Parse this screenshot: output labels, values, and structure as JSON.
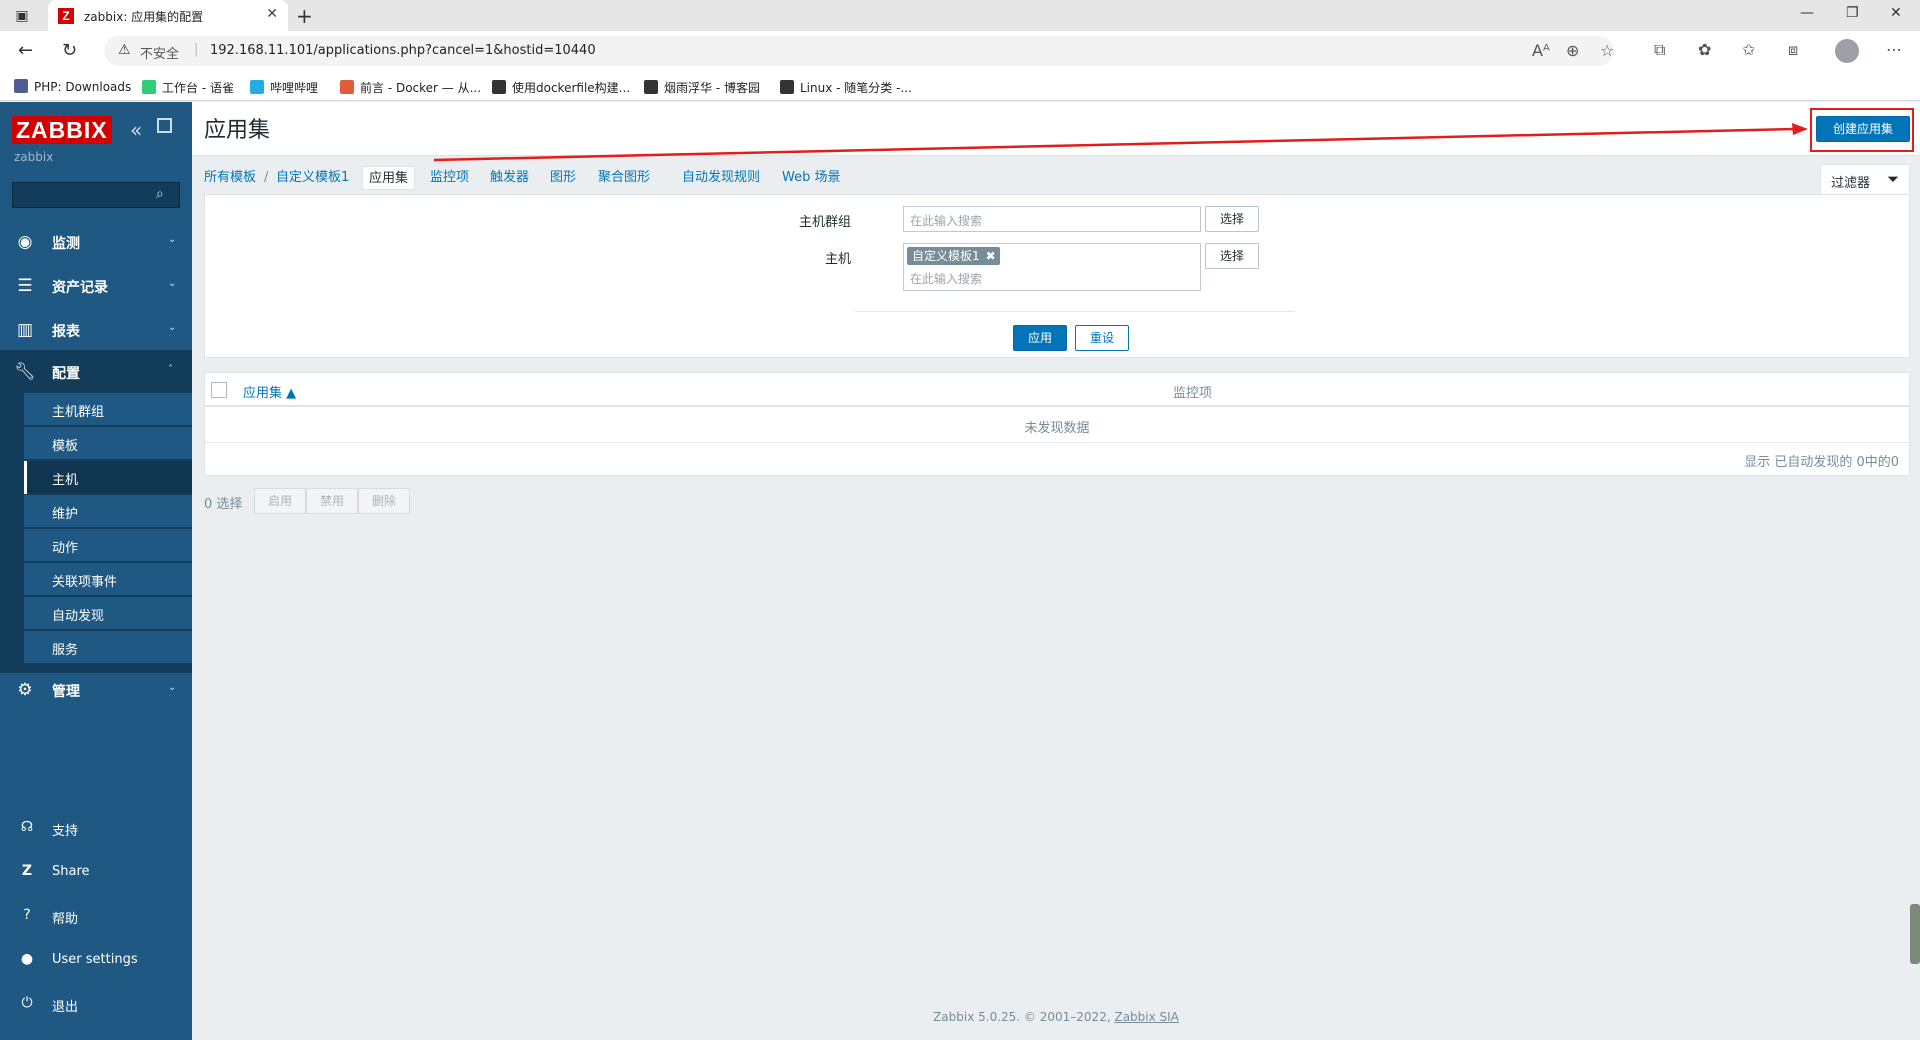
{
  "browser": {
    "tab_title": "zabbix: 应用集的配置",
    "tab_favicon": "Z",
    "insecure_label": "不安全",
    "url": "192.168.11.101/applications.php?cancel=1&hostid=10440",
    "bookmarks": [
      {
        "label": "PHP: Downloads",
        "icon": "php-icon",
        "color": "#4f5b93"
      },
      {
        "label": "工作台 - 语雀",
        "icon": "yuque-icon",
        "color": "#31cc79"
      },
      {
        "label": "哔哩哔哩",
        "icon": "bilibili-icon",
        "color": "#23ade5"
      },
      {
        "label": "前言 - Docker — 从...",
        "icon": "rocket-icon",
        "color": "#e25c3a"
      },
      {
        "label": "使用dockerfile构建...",
        "icon": "cnblogs-icon",
        "color": "#333333"
      },
      {
        "label": "烟雨浮华 - 博客园",
        "icon": "cnblogs-icon",
        "color": "#333333"
      },
      {
        "label": "Linux - 随笔分类 -...",
        "icon": "cnblogs-icon",
        "color": "#333333"
      }
    ]
  },
  "sidebar": {
    "logo": "ZABBIX",
    "server_name": "zabbix",
    "menu": [
      {
        "label": "监测",
        "icon": "eye-icon"
      },
      {
        "label": "资产记录",
        "icon": "list-icon"
      },
      {
        "label": "报表",
        "icon": "chart-icon"
      },
      {
        "label": "配置",
        "icon": "wrench-icon"
      },
      {
        "label": "管理",
        "icon": "gear-icon"
      }
    ],
    "submenu": [
      "主机群组",
      "模板",
      "主机",
      "维护",
      "动作",
      "关联项事件",
      "自动发现",
      "服务"
    ],
    "active_submenu": "主机",
    "bottom": [
      {
        "label": "支持",
        "icon": "headset-icon"
      },
      {
        "label": "Share",
        "icon": "share-icon"
      },
      {
        "label": "帮助",
        "icon": "help-icon"
      },
      {
        "label": "User settings",
        "icon": "user-icon"
      },
      {
        "label": "退出",
        "icon": "power-icon"
      }
    ]
  },
  "header": {
    "title": "应用集",
    "create_button": "创建应用集"
  },
  "nav": {
    "all_templates": "所有模板",
    "separator": "/",
    "template": "自定义模板1",
    "tabs": [
      "应用集",
      "监控项",
      "触发器",
      "图形",
      "聚合图形",
      "自动发现规则",
      "Web 场景"
    ],
    "active_tab": "应用集",
    "filter_label": "过滤器"
  },
  "filter": {
    "host_group_label": "主机群组",
    "host_group_placeholder": "在此输入搜索",
    "host_label": "主机",
    "host_tag": "自定义模板1",
    "host_placeholder": "在此输入搜索",
    "select_button": "选择",
    "apply_button": "应用",
    "reset_button": "重设"
  },
  "table": {
    "col_application": "应用集 ▲",
    "col_items": "监控项",
    "no_data": "未发现数据",
    "paging": "显示 已自动发现的 0中的0"
  },
  "actions": {
    "selected": "0 选择",
    "enable": "启用",
    "disable": "禁用",
    "delete": "删除"
  },
  "footer": {
    "text": "Zabbix 5.0.25. © 2001–2022,",
    "link": "Zabbix SIA"
  },
  "colors": {
    "sidebar": "#1f5883",
    "brand_red": "#d40000",
    "primary_blue": "#0275b8",
    "annotation_red": "#e11d1d"
  }
}
